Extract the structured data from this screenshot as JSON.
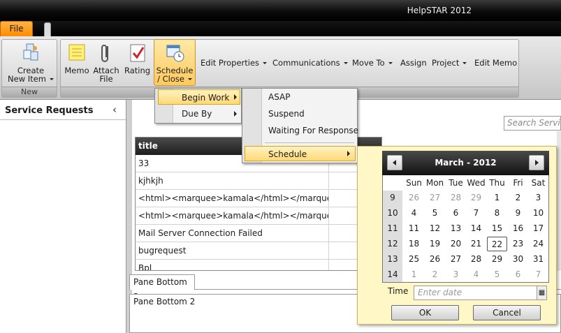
{
  "app": {
    "title": "HelpSTAR 2012"
  },
  "tabs": {
    "file": "File"
  },
  "ribbon": {
    "create_new_item": [
      "Create",
      "New Item"
    ],
    "group_new": "New",
    "memo": "Memo",
    "attach_file": [
      "Attach",
      "File"
    ],
    "rating": "Rating",
    "schedule_close": [
      "Schedule",
      "/ Close"
    ],
    "edit_properties": "Edit Properties",
    "communications": "Communications",
    "move_to": "Move To",
    "assign": "Assign",
    "project": "Project",
    "edit_memo": "Edit Memo"
  },
  "left_pane": {
    "title": "Service Requests",
    "collapse_icon": "‹"
  },
  "search": {
    "placeholder": "Search Service"
  },
  "grid": {
    "header": "title",
    "rows": [
      "33",
      "kjhkjh",
      "<html><marquee>kamala</html></marquee>",
      "<html><marquee>kamala</html></marquee>",
      "Mail Server Connection Failed",
      "bugrequest",
      "Bpl"
    ]
  },
  "pane_bottom": {
    "tab": "Pane Bottom 2",
    "content": "Pane Bottom 2"
  },
  "menu1": {
    "items": [
      "Begin Work",
      "Due By"
    ]
  },
  "menu2": {
    "items": [
      "ASAP",
      "Suspend",
      "Waiting For Response",
      "Schedule"
    ]
  },
  "calendar": {
    "month_label": "March - 2012",
    "dow": [
      "Sun",
      "Mon",
      "Tue",
      "Wed",
      "Thu",
      "Fri",
      "Sat"
    ],
    "weeks": [
      {
        "wk": "9",
        "days": [
          "26",
          "27",
          "28",
          "29",
          "1",
          "2",
          "3"
        ],
        "other": [
          1,
          1,
          1,
          1,
          0,
          0,
          0
        ]
      },
      {
        "wk": "10",
        "days": [
          "4",
          "5",
          "6",
          "7",
          "8",
          "9",
          "10"
        ],
        "other": [
          0,
          0,
          0,
          0,
          0,
          0,
          0
        ]
      },
      {
        "wk": "11",
        "days": [
          "11",
          "12",
          "13",
          "14",
          "15",
          "16",
          "17"
        ],
        "other": [
          0,
          0,
          0,
          0,
          0,
          0,
          0
        ]
      },
      {
        "wk": "12",
        "days": [
          "18",
          "19",
          "20",
          "21",
          "22",
          "23",
          "24"
        ],
        "other": [
          0,
          0,
          0,
          0,
          0,
          0,
          0
        ]
      },
      {
        "wk": "13",
        "days": [
          "25",
          "26",
          "27",
          "28",
          "29",
          "30",
          "31"
        ],
        "other": [
          0,
          0,
          0,
          0,
          0,
          0,
          0
        ]
      },
      {
        "wk": "14",
        "days": [
          "1",
          "2",
          "3",
          "4",
          "5",
          "6",
          "7"
        ],
        "other": [
          1,
          1,
          1,
          1,
          1,
          1,
          1
        ]
      }
    ],
    "today": "22",
    "time_label": "Time",
    "time_placeholder": "Enter date",
    "ok": "OK",
    "cancel": "Cancel"
  },
  "colors": {
    "file_tab": "#ff9a1a",
    "highlight": "#ffd978",
    "calendar_bg": "#fff8c6"
  }
}
